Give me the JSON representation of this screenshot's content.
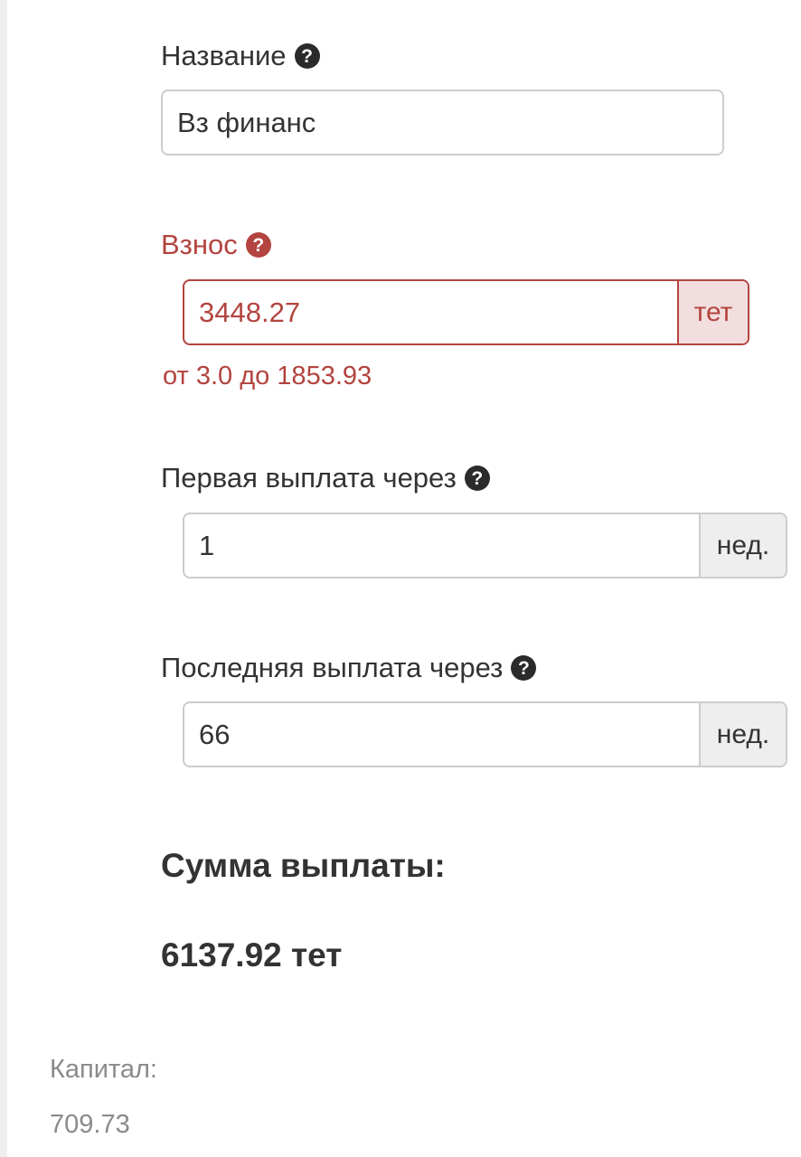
{
  "form": {
    "name": {
      "label": "Название",
      "value": "Вз финанс"
    },
    "deposit": {
      "label": "Взнос",
      "value": "3448.27",
      "unit": "тет",
      "error": "от 3.0 до 1853.93"
    },
    "first_payment": {
      "label": "Первая выплата через",
      "value": "1",
      "unit": "нед."
    },
    "last_payment": {
      "label": "Последняя выплата через",
      "value": "66",
      "unit": "нед."
    }
  },
  "summary": {
    "title": "Сумма выплаты:",
    "amount": "6137.92 тет"
  },
  "capital": {
    "label": "Капитал:",
    "value": "709.73"
  },
  "icons": {
    "help": "question-circle-icon",
    "help_glyph": "?"
  },
  "colors": {
    "error": "#b3443f",
    "error_bg": "#f2dede",
    "text": "#333333",
    "muted": "#8a8a8a",
    "border": "#cccccc",
    "addon_bg": "#eeeeee"
  }
}
